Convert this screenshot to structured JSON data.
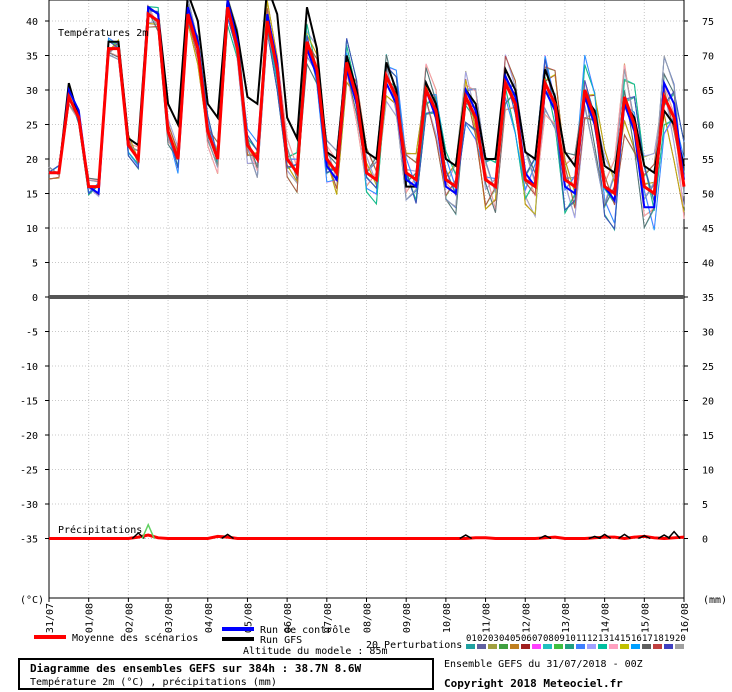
{
  "chart_data": {
    "type": "line",
    "annotations": {
      "temperature_panel": "Températures 2m",
      "precip_panel": "Précipitations",
      "left_unit": "(°C)",
      "right_unit": "(mm)",
      "altitude": "Altitude du modele : 85m"
    },
    "y_left": {
      "ylim": [
        -35,
        40
      ],
      "ticks": [
        40,
        35,
        30,
        25,
        20,
        15,
        10,
        5,
        0,
        -5,
        -10,
        -15,
        -20,
        -25,
        -30,
        -35
      ]
    },
    "y_right": {
      "ticks": [
        75,
        70,
        65,
        60,
        55,
        50,
        45,
        40,
        35,
        30,
        25,
        20,
        15,
        10,
        5,
        0
      ]
    },
    "x_labels": [
      "31/07",
      "01/08",
      "02/08",
      "03/08",
      "04/08",
      "05/08",
      "06/08",
      "07/08",
      "08/08",
      "09/08",
      "10/08",
      "11/08",
      "12/08",
      "13/08",
      "14/08",
      "15/08",
      "16/08"
    ],
    "x_range_hours": [
      0,
      384
    ],
    "grid": true,
    "series": [
      {
        "name": "Moyenne des scénarios",
        "color": "#ff0000",
        "x_hours": [
          0,
          6,
          12,
          18,
          24,
          30,
          36,
          42,
          48,
          54,
          60,
          66,
          72,
          78,
          84,
          90,
          96,
          102,
          108,
          114,
          120,
          126,
          132,
          138,
          144,
          150,
          156,
          162,
          168,
          174,
          180,
          186,
          192,
          198,
          204,
          210,
          216,
          222,
          228,
          234,
          240,
          246,
          252,
          258,
          264,
          270,
          276,
          282,
          288,
          294,
          300,
          306,
          312,
          318,
          324,
          330,
          336,
          342,
          348,
          354,
          360,
          366,
          372,
          378,
          384
        ],
        "values": [
          18,
          18,
          29,
          26,
          16,
          16,
          36,
          36,
          22,
          20,
          41,
          40,
          24,
          20,
          41,
          36,
          24,
          20,
          42,
          36,
          22,
          20,
          40,
          33,
          20,
          18,
          37,
          33,
          20,
          18,
          34,
          29,
          18,
          17,
          32,
          29,
          18,
          17,
          30,
          27,
          17,
          16,
          29,
          26,
          17,
          16,
          31,
          28,
          17,
          16,
          31,
          28,
          17,
          16,
          30,
          26,
          16,
          15,
          29,
          25,
          16,
          15,
          29,
          26,
          16
        ]
      },
      {
        "name": "Run de contrôle",
        "color": "#0000ff",
        "x_hours": [
          0,
          6,
          12,
          18,
          24,
          30,
          36,
          42,
          48,
          54,
          60,
          66,
          72,
          78,
          84,
          90,
          96,
          102,
          108,
          114,
          120,
          126,
          132,
          138,
          144,
          150,
          156,
          162,
          168,
          174,
          180,
          186,
          192,
          198,
          204,
          210,
          216,
          222,
          228,
          234,
          240,
          246,
          252,
          258,
          264,
          270,
          276,
          282,
          288,
          294,
          300,
          306,
          312,
          318,
          324,
          330,
          336,
          342,
          348,
          354,
          360,
          366,
          372,
          378,
          384
        ],
        "values": [
          18,
          18,
          30,
          27,
          16,
          15,
          36,
          36,
          22,
          20,
          42,
          41,
          24,
          20,
          42,
          37,
          24,
          20,
          43,
          37,
          22,
          20,
          41,
          34,
          20,
          18,
          36,
          32,
          19,
          17,
          33,
          28,
          18,
          17,
          31,
          28,
          17,
          16,
          30,
          26,
          16,
          15,
          30,
          27,
          17,
          16,
          32,
          29,
          18,
          16,
          30,
          27,
          16,
          15,
          29,
          25,
          16,
          14,
          28,
          24,
          13,
          13,
          31,
          28,
          17
        ]
      },
      {
        "name": "Run GFS",
        "color": "#000000",
        "x_hours": [
          0,
          6,
          12,
          18,
          24,
          30,
          36,
          42,
          48,
          54,
          60,
          66,
          72,
          78,
          84,
          90,
          96,
          102,
          108,
          114,
          120,
          126,
          132,
          138,
          144,
          150,
          156,
          162,
          168,
          174,
          180,
          186,
          192,
          198,
          204,
          210,
          216,
          222,
          228,
          234,
          240,
          246,
          252,
          258,
          264,
          270,
          276,
          282,
          288,
          294,
          300,
          306,
          312,
          318,
          324,
          330,
          336,
          342,
          348,
          354,
          360,
          366,
          372,
          378,
          384
        ],
        "values": [
          18,
          18,
          31,
          26,
          16,
          16,
          37,
          37,
          23,
          22,
          42,
          41,
          28,
          25,
          44,
          40,
          28,
          26,
          43,
          38,
          29,
          28,
          45,
          41,
          26,
          23,
          42,
          36,
          21,
          20,
          35,
          30,
          21,
          20,
          34,
          30,
          16,
          16,
          31,
          28,
          20,
          19,
          30,
          28,
          20,
          20,
          33,
          30,
          21,
          20,
          33,
          29,
          21,
          19,
          29,
          27,
          19,
          18,
          28,
          26,
          19,
          18,
          27,
          25,
          19
        ]
      }
    ],
    "precipitation": {
      "unit_scale_note": "mm, right axis 0 at -35 left",
      "mean": [
        0,
        0,
        0,
        0,
        0,
        0,
        0,
        0,
        0,
        0.2,
        0.5,
        0.1,
        0,
        0,
        0,
        0,
        0,
        0.3,
        0.2,
        0,
        0,
        0,
        0,
        0,
        0,
        0,
        0,
        0,
        0,
        0,
        0,
        0,
        0,
        0,
        0,
        0,
        0,
        0,
        0,
        0,
        0,
        0,
        0,
        0.1,
        0.1,
        0,
        0,
        0,
        0,
        0,
        0.1,
        0.2,
        0,
        0,
        0,
        0.1,
        0.2,
        0.2,
        0,
        0.2,
        0.3,
        0.1,
        0,
        0.1,
        0.2
      ],
      "spike_hours": [
        54,
        60,
        108,
        252,
        300,
        330,
        336,
        348,
        360,
        372,
        378
      ],
      "spike_values": [
        0.8,
        2,
        0.6,
        0.5,
        0.4,
        0.3,
        0.6,
        0.6,
        0.4,
        0.5,
        1
      ]
    },
    "legend": {
      "mean_label": "Moyenne des scénarios",
      "control_label": "Run de contrôle",
      "gfs_label": "Run GFS",
      "perturbations_label": "20 Perturbations",
      "perturbation_numbers": [
        "01",
        "02",
        "03",
        "04",
        "05",
        "06",
        "07",
        "08",
        "09",
        "10",
        "11",
        "12",
        "13",
        "14",
        "15",
        "16",
        "17",
        "18",
        "19",
        "20"
      ],
      "perturbation_colors": [
        "#20a0a0",
        "#6060a0",
        "#a0a040",
        "#40a040",
        "#c08020",
        "#a02020",
        "#ff40ff",
        "#20c0c0",
        "#40c040",
        "#20a080",
        "#4080ff",
        "#a0a0ff",
        "#00c0a0",
        "#ffa0c0",
        "#c0c000",
        "#00a0ff",
        "#606060",
        "#c04040",
        "#4040c0",
        "#a0a0a0"
      ]
    }
  },
  "footer": {
    "title": "Diagramme des ensembles GEFS sur 384h : 38.7N 8.6W",
    "subtitle": "Température 2m (°C) , précipitations (mm)",
    "run_info": "Ensemble GEFS du 31/07/2018 - 00Z",
    "copyright": "Copyright 2018 Meteociel.fr"
  }
}
